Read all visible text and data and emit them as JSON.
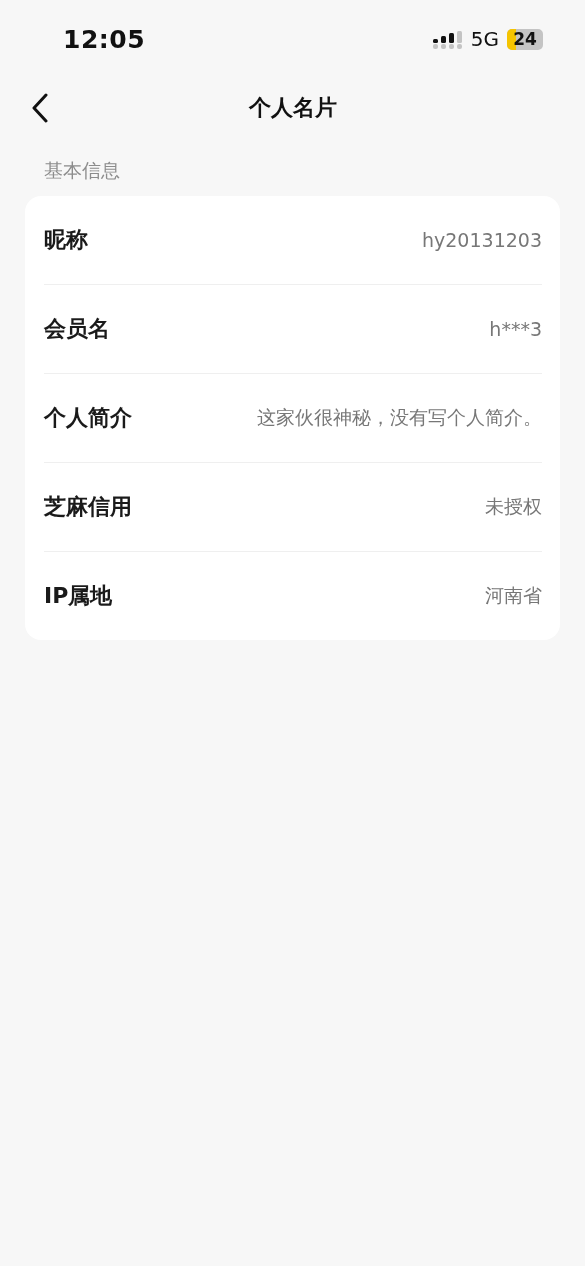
{
  "status_bar": {
    "time": "12:05",
    "network": "5G",
    "battery": "24"
  },
  "header": {
    "title": "个人名片"
  },
  "section": {
    "title": "基本信息"
  },
  "rows": [
    {
      "label": "昵称",
      "value": "hy20131203"
    },
    {
      "label": "会员名",
      "value": "h***3"
    },
    {
      "label": "个人简介",
      "value": "这家伙很神秘，没有写个人简介。"
    },
    {
      "label": "芝麻信用",
      "value": "未授权"
    },
    {
      "label": "IP属地",
      "value": "河南省"
    }
  ]
}
